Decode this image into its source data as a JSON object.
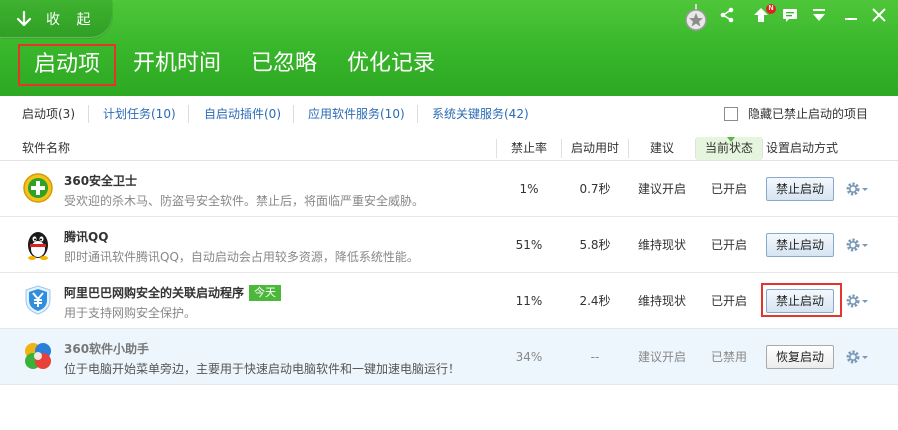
{
  "header": {
    "collapse_label": "收 起",
    "main_tabs": [
      {
        "label": "启动项",
        "active": true
      },
      {
        "label": "开机时间",
        "active": false
      },
      {
        "label": "已忽略",
        "active": false
      },
      {
        "label": "优化记录",
        "active": false
      }
    ],
    "toolbar_icons": [
      "share-icon",
      "upgrade-icon",
      "message-icon",
      "menu-icon",
      "minimize-icon",
      "close-icon"
    ],
    "notification_badge": "N",
    "accent_color": "#37b52a"
  },
  "subtabs": {
    "items": [
      {
        "label": "启动项(3)",
        "active": true
      },
      {
        "label": "计划任务(10)",
        "active": false
      },
      {
        "label": "自启动插件(0)",
        "active": false
      },
      {
        "label": "应用软件服务(10)",
        "active": false
      },
      {
        "label": "系统关键服务(42)",
        "active": false
      }
    ],
    "hide_disabled_label": "隐藏已禁止启动的项目",
    "hide_disabled_checked": false
  },
  "table": {
    "columns": {
      "name": "软件名称",
      "disable_rate": "禁止率",
      "startup_time": "启动用时",
      "suggestion": "建议",
      "status": "当前状态",
      "setting": "设置启动方式"
    },
    "rows": [
      {
        "name": "360安全卫士",
        "desc": "受欢迎的杀木马、防盗号安全软件。禁止后，将面临严重安全威胁。",
        "tag": "",
        "disable_rate": "1%",
        "startup_time": "0.7秒",
        "suggestion": "建议开启",
        "status": "已开启",
        "action": "禁止启动"
      },
      {
        "name": "腾讯QQ",
        "desc": "即时通讯软件腾讯QQ，自动启动会占用较多资源，降低系统性能。",
        "tag": "",
        "disable_rate": "51%",
        "startup_time": "5.8秒",
        "suggestion": "维持现状",
        "status": "已开启",
        "action": "禁止启动"
      },
      {
        "name": "阿里巴巴网购安全的关联启动程序",
        "desc": "用于支持网购安全保护。",
        "tag": "今天",
        "disable_rate": "11%",
        "startup_time": "2.4秒",
        "suggestion": "维持现状",
        "status": "已开启",
        "action": "禁止启动"
      },
      {
        "name": "360软件小助手",
        "desc": "位于电脑开始菜单旁边，主要用于快速启动电脑软件和一键加速电脑运行！",
        "tag": "",
        "disable_rate": "34%",
        "startup_time": "--",
        "suggestion": "建议开启",
        "status": "已禁用",
        "action": "恢复启动"
      }
    ]
  }
}
